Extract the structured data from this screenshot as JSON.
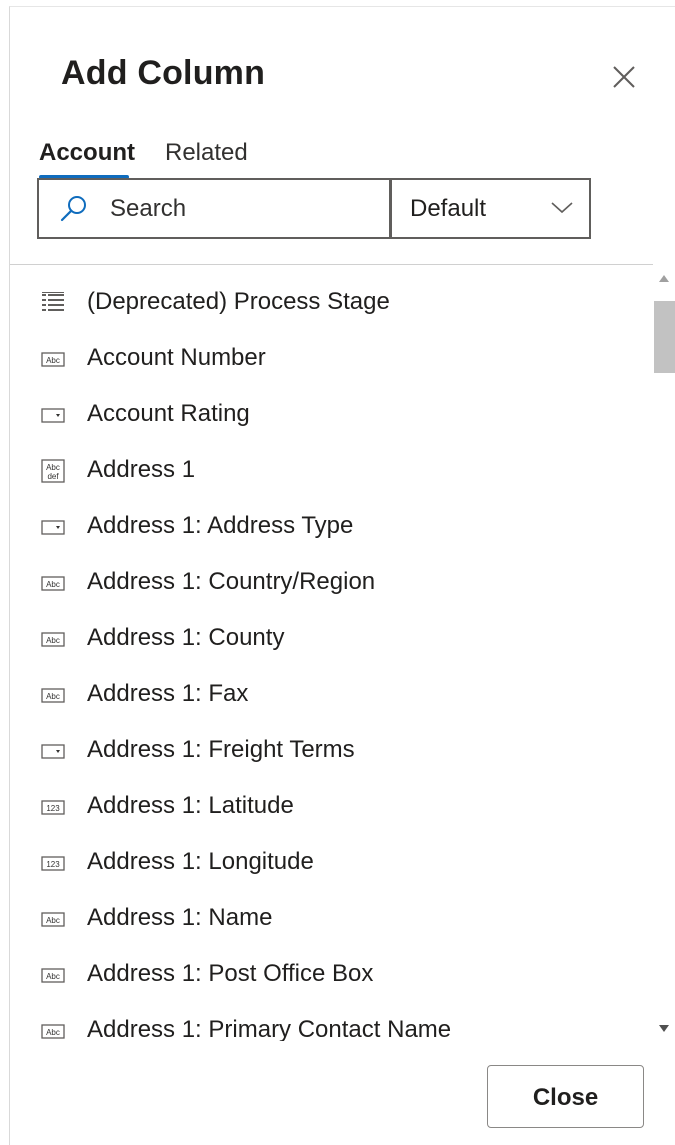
{
  "dialog": {
    "title": "Add Column"
  },
  "tabs": [
    {
      "label": "Account",
      "selected": true
    },
    {
      "label": "Related",
      "selected": false
    }
  ],
  "search": {
    "placeholder": "Search",
    "value": ""
  },
  "filter": {
    "selected": "Default"
  },
  "columns": [
    {
      "label": "(Deprecated) Process Stage",
      "icon": "lookup-list-icon"
    },
    {
      "label": "Account Number",
      "icon": "text-abc-icon"
    },
    {
      "label": "Account Rating",
      "icon": "option-set-icon"
    },
    {
      "label": "Address 1",
      "icon": "multiline-text-icon"
    },
    {
      "label": "Address 1: Address Type",
      "icon": "option-set-icon"
    },
    {
      "label": "Address 1: Country/Region",
      "icon": "text-abc-icon"
    },
    {
      "label": "Address 1: County",
      "icon": "text-abc-icon"
    },
    {
      "label": "Address 1: Fax",
      "icon": "text-abc-icon"
    },
    {
      "label": "Address 1: Freight Terms",
      "icon": "option-set-icon"
    },
    {
      "label": "Address 1: Latitude",
      "icon": "number-123-icon"
    },
    {
      "label": "Address 1: Longitude",
      "icon": "number-123-icon"
    },
    {
      "label": "Address 1: Name",
      "icon": "text-abc-icon"
    },
    {
      "label": "Address 1: Post Office Box",
      "icon": "text-abc-icon"
    },
    {
      "label": "Address 1: Primary Contact Name",
      "icon": "text-abc-icon"
    }
  ],
  "footer": {
    "close_label": "Close"
  },
  "colors": {
    "accent": "#0f6cbd",
    "text": "#201f1e",
    "border": "#605e5c"
  }
}
